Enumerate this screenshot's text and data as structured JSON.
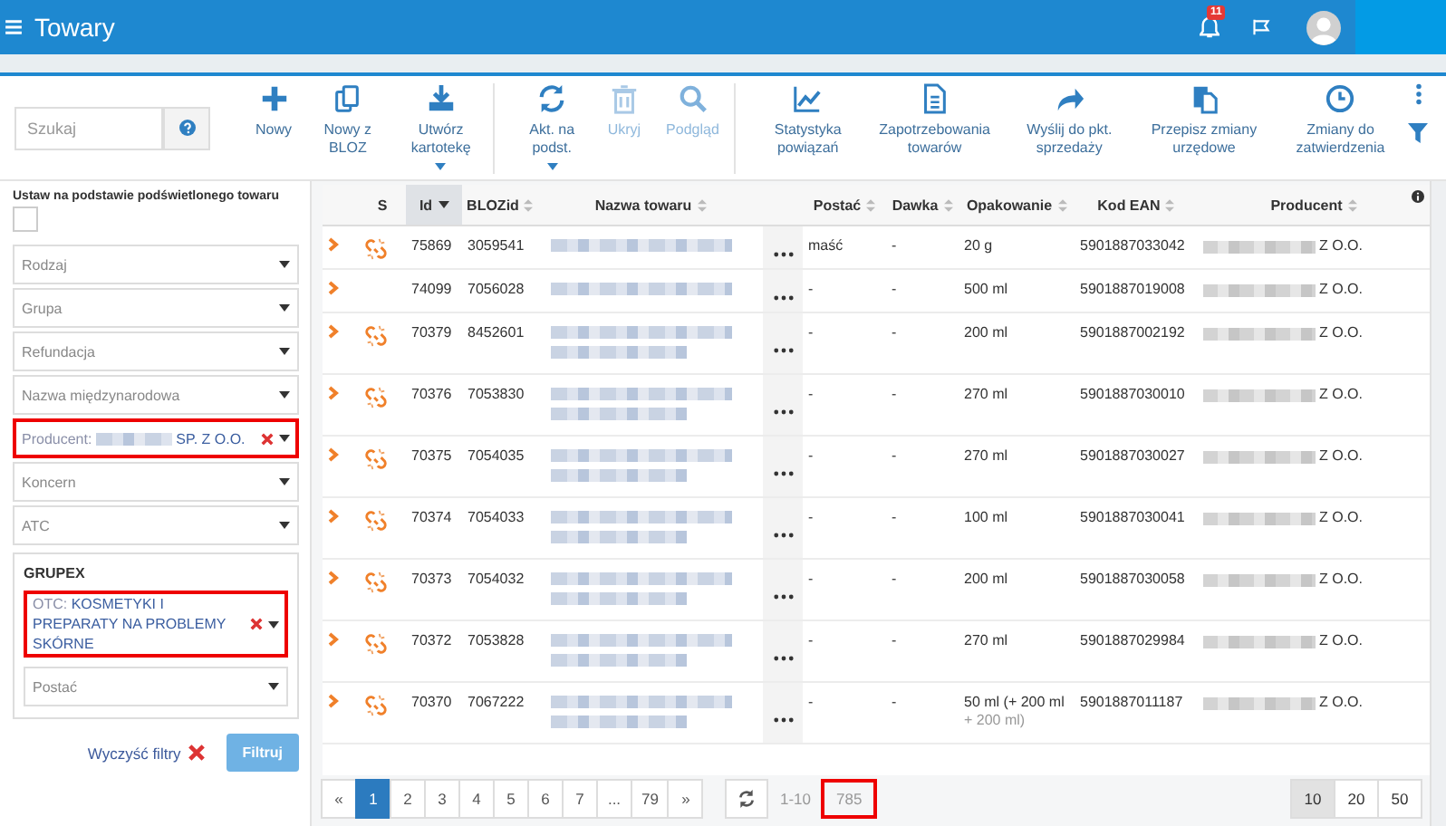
{
  "topbar": {
    "title": "Towary",
    "notifications": "11"
  },
  "search": {
    "placeholder": "Szukaj"
  },
  "toolbar": [
    {
      "label": "Nowy",
      "disabled": false,
      "has_menu": false,
      "group_end": false
    },
    {
      "label": "Nowy z BLOZ",
      "disabled": false,
      "has_menu": false,
      "group_end": false
    },
    {
      "label": "Utwórz kartotekę",
      "disabled": false,
      "has_menu": true,
      "group_end": true
    },
    {
      "label": "Akt. na podst.",
      "disabled": false,
      "has_menu": true,
      "group_end": false
    },
    {
      "label": "Ukryj",
      "disabled": true,
      "has_menu": false,
      "group_end": false
    },
    {
      "label": "Podgląd",
      "disabled": true,
      "has_menu": false,
      "group_end": true
    },
    {
      "label": "Statystyka powiązań",
      "disabled": false,
      "has_menu": false,
      "group_end": false
    },
    {
      "label": "Zapotrzebowania towarów",
      "disabled": false,
      "has_menu": false,
      "group_end": false
    },
    {
      "label": "Wyślij do pkt. sprzedaży",
      "disabled": false,
      "has_menu": false,
      "group_end": false
    },
    {
      "label": "Przepisz zmiany urzędowe",
      "disabled": false,
      "has_menu": false,
      "group_end": false
    },
    {
      "label": "Zmiany do zatwierdzenia",
      "disabled": false,
      "has_menu": false,
      "group_end": false
    }
  ],
  "filters": {
    "title": "Ustaw na podstawie podświetlonego towaru",
    "checked": false,
    "selects": [
      {
        "kind": "empty",
        "placeholder": "Rodzaj"
      },
      {
        "kind": "empty",
        "placeholder": "Grupa"
      },
      {
        "kind": "empty",
        "placeholder": "Refundacja"
      },
      {
        "kind": "empty",
        "placeholder": "Nazwa międzynarodowa"
      },
      {
        "kind": "value",
        "label": "Producent:",
        "value": "SP. Z O.O.",
        "blurred": true,
        "highlighted": true
      },
      {
        "kind": "empty",
        "placeholder": "Koncern"
      },
      {
        "kind": "empty",
        "placeholder": "ATC"
      }
    ],
    "group": {
      "title": "GRUPEX",
      "selects": [
        {
          "kind": "value",
          "label": "OTC:",
          "value": "KOSMETYKI I PREPARATY NA PROBLEMY SKÓRNE",
          "blurred": false,
          "highlighted": true
        },
        {
          "kind": "empty",
          "placeholder": "Postać"
        }
      ]
    },
    "clear_link": "Wyczyść filtry",
    "filter_button": "Filtruj"
  },
  "table": {
    "columns": [
      {
        "sortable": false,
        "sorted": false
      },
      {
        "label": "S",
        "sortable": false,
        "sorted": false
      },
      {
        "label": "Id",
        "sortable": true,
        "sorted": true
      },
      {
        "label": "BLOZid",
        "sortable": true,
        "sorted": false
      },
      {
        "label": "Nazwa towaru",
        "sortable": true,
        "sorted": false
      },
      {
        "sortable": false,
        "sorted": false
      },
      {
        "label": "Postać",
        "sortable": true,
        "sorted": false
      },
      {
        "label": "Dawka",
        "sortable": true,
        "sorted": false
      },
      {
        "label": "Opakowanie",
        "sortable": true,
        "sorted": false
      },
      {
        "label": "Kod EAN",
        "sortable": true,
        "sorted": false
      },
      {
        "label": "Producent",
        "sortable": true,
        "sorted": false
      }
    ],
    "rows": [
      {
        "linked": true,
        "id": "75869",
        "bloz": "3059541",
        "name_wraps": false,
        "form": "maść",
        "dose": "-",
        "pack": "20 g",
        "ean": "5901887033042",
        "producer": "Z O.O."
      },
      {
        "linked": false,
        "id": "74099",
        "bloz": "7056028",
        "name_wraps": false,
        "form": "-",
        "dose": "-",
        "pack": "500 ml",
        "ean": "5901887019008",
        "producer": "Z O.O."
      },
      {
        "linked": true,
        "id": "70379",
        "bloz": "8452601",
        "name_wraps": true,
        "form": "-",
        "dose": "-",
        "pack": "200 ml",
        "ean": "5901887002192",
        "producer": "Z O.O."
      },
      {
        "linked": true,
        "id": "70376",
        "bloz": "7053830",
        "name_wraps": true,
        "form": "-",
        "dose": "-",
        "pack": "270 ml",
        "ean": "5901887030010",
        "producer": "Z O.O."
      },
      {
        "linked": true,
        "id": "70375",
        "bloz": "7054035",
        "name_wraps": true,
        "form": "-",
        "dose": "-",
        "pack": "270 ml",
        "ean": "5901887030027",
        "producer": "Z O.O."
      },
      {
        "linked": true,
        "id": "70374",
        "bloz": "7054033",
        "name_wraps": true,
        "form": "-",
        "dose": "-",
        "pack": "100 ml",
        "ean": "5901887030041",
        "producer": "Z O.O."
      },
      {
        "linked": true,
        "id": "70373",
        "bloz": "7054032",
        "name_wraps": true,
        "form": "-",
        "dose": "-",
        "pack": "200 ml",
        "ean": "5901887030058",
        "producer": "Z O.O."
      },
      {
        "linked": true,
        "id": "70372",
        "bloz": "7053828",
        "name_wraps": true,
        "form": "-",
        "dose": "-",
        "pack": "270 ml",
        "ean": "5901887029984",
        "producer": "Z O.O."
      },
      {
        "linked": true,
        "id": "70370",
        "bloz": "7067222",
        "name_wraps": true,
        "form": "-",
        "dose": "-",
        "pack": "50 ml (+ 200 ml",
        "pack_more": "+ 200 ml)",
        "ean": "5901887011187",
        "producer": "Z O.O."
      }
    ]
  },
  "pagination": {
    "pages": [
      {
        "label": "«",
        "selected": false
      },
      {
        "label": "1",
        "selected": true
      },
      {
        "label": "2",
        "selected": false
      },
      {
        "label": "3",
        "selected": false
      },
      {
        "label": "4",
        "selected": false
      },
      {
        "label": "5",
        "selected": false
      },
      {
        "label": "6",
        "selected": false
      },
      {
        "label": "7",
        "selected": false
      },
      {
        "label": "...",
        "selected": false
      },
      {
        "label": "79",
        "selected": false
      },
      {
        "label": "»",
        "selected": false
      }
    ],
    "range": "1-10",
    "total": "785",
    "total_highlighted": true,
    "page_sizes": [
      {
        "label": "10",
        "selected": true
      },
      {
        "label": "20",
        "selected": false
      },
      {
        "label": "50",
        "selected": false
      }
    ]
  }
}
